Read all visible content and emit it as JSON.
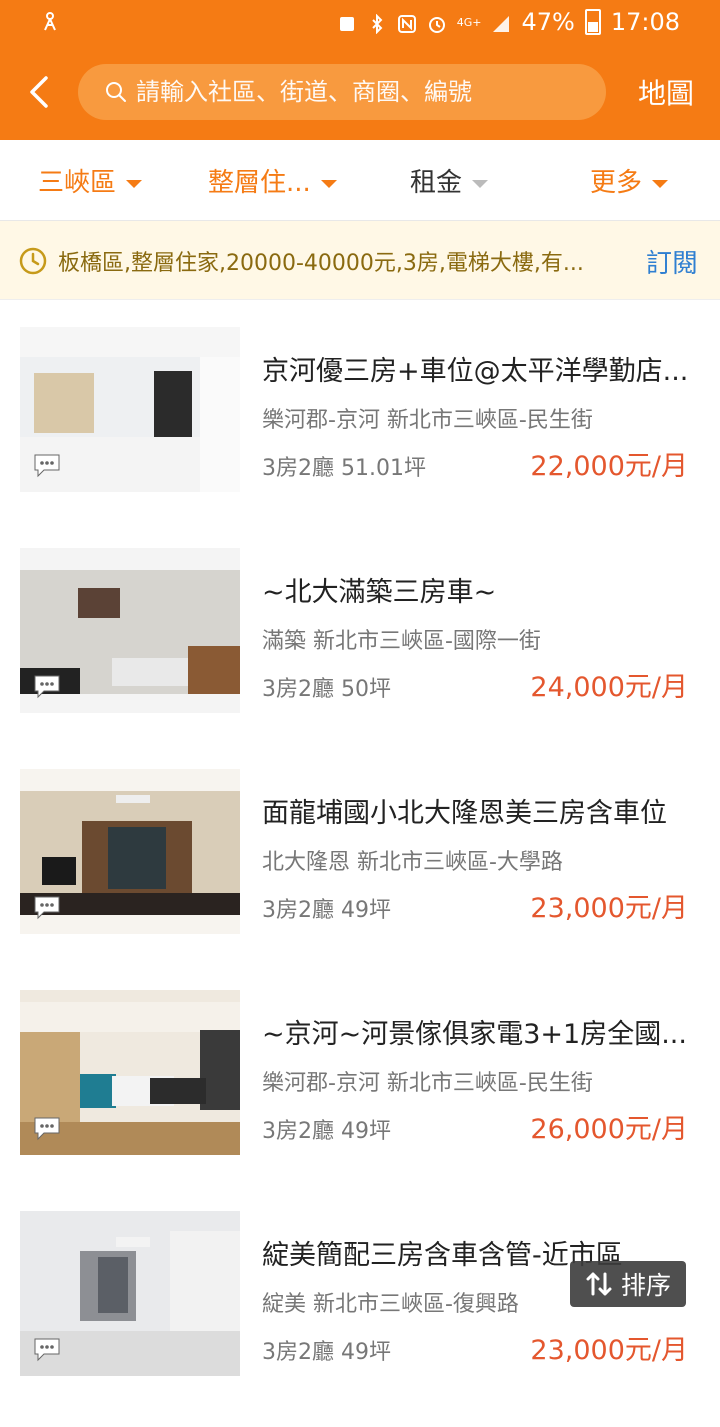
{
  "status": {
    "battery": "47%",
    "time": "17:08",
    "network": "4G+"
  },
  "header": {
    "search_placeholder": "請輸入社區、街道、商圈、編號",
    "map_label": "地圖"
  },
  "filters": [
    {
      "label": "三峽區",
      "active": true
    },
    {
      "label": "整層住...",
      "active": true
    },
    {
      "label": "租金",
      "active": false
    },
    {
      "label": "更多",
      "active": true
    }
  ],
  "saved_search": {
    "text": "板橋區,整層住家,20000-40000元,3房,電梯大樓,有...",
    "subscribe_label": "訂閱"
  },
  "listings": [
    {
      "title": "京河優三房+車位@太平洋學勤店...",
      "address": "樂河郡-京河 新北市三峽區-民生街",
      "spec": "3房2廳  51.01坪",
      "price": "22,000元/月"
    },
    {
      "title": "~北大滿築三房車~",
      "address": "滿築 新北市三峽區-國際一街",
      "spec": "3房2廳  50坪",
      "price": "24,000元/月"
    },
    {
      "title": "面龍埔國小北大隆恩美三房含車位",
      "address": "北大隆恩 新北市三峽區-大學路",
      "spec": "3房2廳  49坪",
      "price": "23,000元/月"
    },
    {
      "title": "~京河~河景傢俱家電3+1房全國...",
      "address": "樂河郡-京河 新北市三峽區-民生街",
      "spec": "3房2廳  49坪",
      "price": "26,000元/月"
    },
    {
      "title": "綻美簡配三房含車含管-近市區",
      "address": "綻美 新北市三峽區-復興路",
      "spec": "3房2廳  49坪",
      "price": "23,000元/月"
    }
  ],
  "sort_label": "排序",
  "colors": {
    "brand": "#f57b14",
    "price": "#e4572e",
    "link": "#2f7fd1"
  }
}
